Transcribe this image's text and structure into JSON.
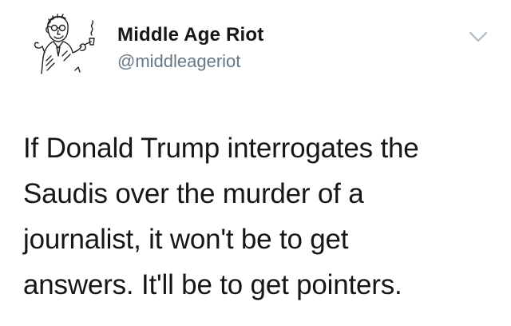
{
  "author": {
    "display_name": "Middle Age Riot",
    "handle": "@middleageriot",
    "avatar_icon": "vintage-man-smoking-pipe-illustration"
  },
  "menu": {
    "icon": "chevron-down-icon"
  },
  "tweet": {
    "text": "If Donald Trump interrogates the\nSaudis over the murder of a\njournalist, it won't be to get\nanswers. It'll be to get pointers."
  },
  "colors": {
    "text_primary": "#14171a",
    "text_secondary": "#657786",
    "icon_gray": "#aab8c2",
    "background": "#ffffff"
  }
}
